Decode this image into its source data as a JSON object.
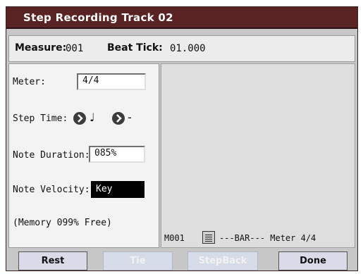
{
  "window": {
    "title": "Step Recording Track 02"
  },
  "info": {
    "measure_label": "Measure:",
    "measure_value": "001",
    "beat_tick_label": "Beat Tick:",
    "beat_tick_value": "01.000"
  },
  "params": {
    "meter": {
      "label": "Meter:",
      "value": "4/4"
    },
    "step_time": {
      "label": "Step Time:",
      "note_glyph": "♩",
      "modifier": "-"
    },
    "note_duration": {
      "label": "Note Duration:",
      "value": "085%"
    },
    "note_velocity": {
      "label": "Note Velocity:",
      "value": "Key"
    },
    "memory": "(Memory  099% Free)"
  },
  "event_list": {
    "measure": "M001",
    "icon": "list-icon",
    "entry": "---BAR--- Meter 4/4"
  },
  "buttons": {
    "rest": "Rest",
    "tie": "Tie",
    "stepback": "StepBack",
    "done": "Done"
  },
  "colors": {
    "titlebar": "#5a2323",
    "panel": "#f3f3f3",
    "selected": "#000000",
    "button": "#d9dbe8"
  }
}
